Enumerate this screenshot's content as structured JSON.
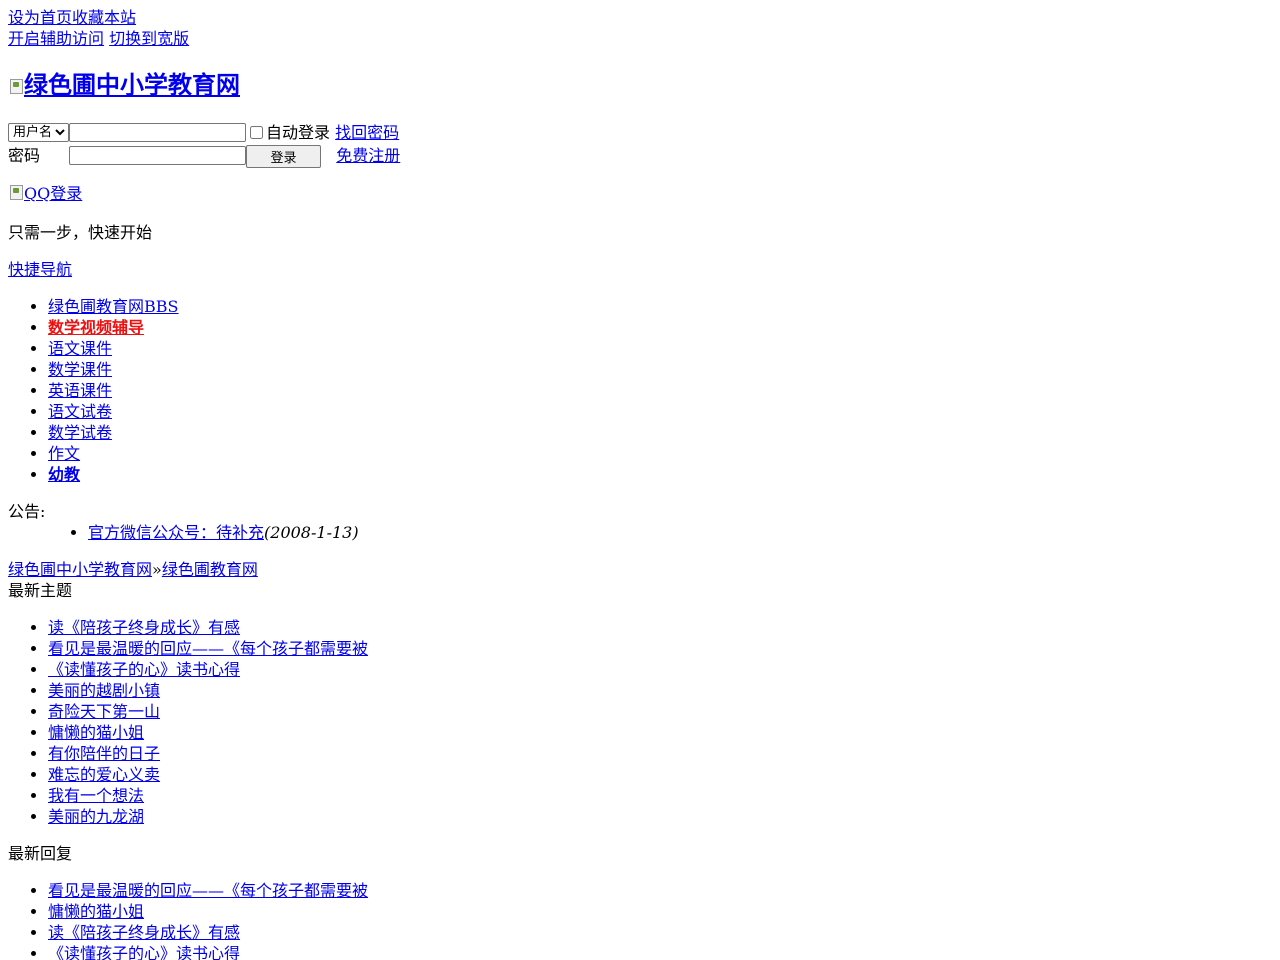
{
  "top_links": {
    "set_home": "设为首页",
    "bookmark": "收藏本站",
    "accessibility": "开启辅助访问",
    "wide_layout": "切换到宽版"
  },
  "logo": {
    "alt_text": "绿色圃中小学教育网"
  },
  "login": {
    "username_select": "用户名",
    "auto_login": "自动登录",
    "forgot_password": "找回密码",
    "password_label": "密码",
    "login_button": "登录",
    "register": "免费注册"
  },
  "qq_login": "QQ登录",
  "one_step": "只需一步，快速开始",
  "quick_nav": "快捷导航",
  "nav_items": [
    {
      "label": "绿色圃教育网BBS"
    },
    {
      "label": "数学视频辅导"
    },
    {
      "label": "语文课件"
    },
    {
      "label": "数学课件"
    },
    {
      "label": "英语课件"
    },
    {
      "label": "语文试卷"
    },
    {
      "label": "数学试卷"
    },
    {
      "label": "作文"
    },
    {
      "label": "幼教"
    }
  ],
  "notice": {
    "label": "公告:",
    "items": [
      {
        "text": "官方微信公众号：待补充",
        "date": "(2008-1-13)"
      }
    ]
  },
  "breadcrumb": {
    "home": "绿色圃中小学教育网",
    "separator": "»",
    "current": "绿色圃教育网"
  },
  "latest_topics": {
    "heading": "最新主题",
    "items": [
      "读《陪孩子终身成长》有感",
      "看见是最温暖的回应——《每个孩子都需要被",
      "《读懂孩子的心》读书心得",
      "美丽的越剧小镇",
      "奇险天下第一山",
      "慵懒的猫小姐",
      "有你陪伴的日子",
      "难忘的爱心义卖",
      "我有一个想法",
      "美丽的九龙湖"
    ]
  },
  "latest_replies": {
    "heading": "最新回复",
    "items": [
      "看见是最温暖的回应——《每个孩子都需要被",
      "慵懒的猫小姐",
      "读《陪孩子终身成长》有感",
      "《读懂孩子的心》读书心得"
    ]
  },
  "colors": {
    "link": "#0000ee",
    "highlight_red": "#ee1111",
    "background": "#ffffff",
    "text": "#000000"
  }
}
